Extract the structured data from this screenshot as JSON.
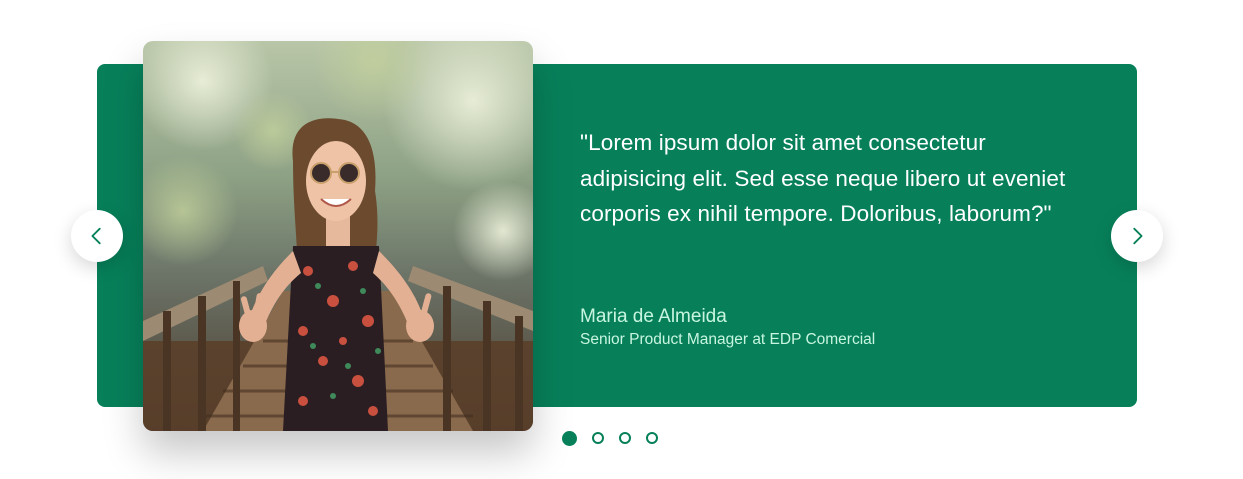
{
  "testimonial": {
    "quote": "\"Lorem ipsum dolor sit amet consectetur adipisicing elit. Sed esse neque libero ut eveniet corporis ex nihil tempore. Doloribus, laborum?\"",
    "author_name": "Maria de Almeida",
    "author_role": "Senior Product Manager at EDP Comercial"
  },
  "navigation": {
    "prev_icon": "chevron-left-icon",
    "next_icon": "chevron-right-icon"
  },
  "pagination": {
    "total": 4,
    "active_index": 0
  },
  "colors": {
    "accent": "#07805a",
    "author_text": "#c8f5e0",
    "quote_text": "#ffffff"
  }
}
